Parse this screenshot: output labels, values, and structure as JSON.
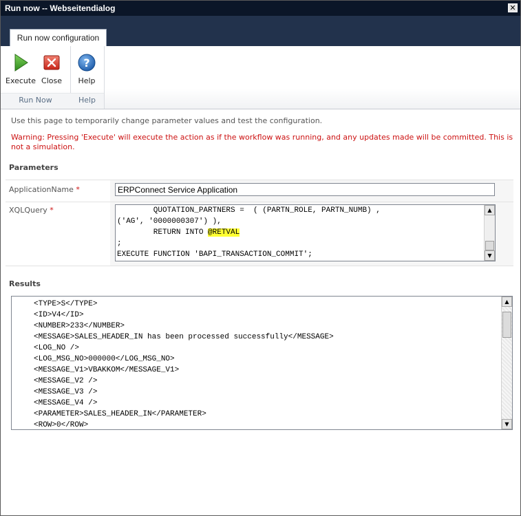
{
  "window": {
    "title": "Run now -- Webseitendialog",
    "close_glyph": "✕"
  },
  "ribbon": {
    "tab": "Run now configuration",
    "groups": [
      {
        "label": "Run Now",
        "buttons": [
          {
            "label": "Execute",
            "icon": "play-icon"
          },
          {
            "label": "Close",
            "icon": "close-icon"
          }
        ]
      },
      {
        "label": "Help",
        "buttons": [
          {
            "label": "Help",
            "icon": "help-icon"
          }
        ]
      }
    ]
  },
  "page": {
    "info": "Use this page to temporarily change parameter values and test the configuration.",
    "warning": "Warning: Pressing 'Execute' will execute the action as if the workflow was running, and any updates made will be committed. This is not a simulation.",
    "parameters_heading": "Parameters",
    "results_heading": "Results",
    "required_marker": "*"
  },
  "params": {
    "application_name": {
      "label": "ApplicationName",
      "value": "ERPConnect Service Application"
    },
    "xql_query": {
      "label": "XQLQuery",
      "line1": "        QUOTATION_PARTNERS =  ( (PARTN_ROLE, PARTN_NUMB) ,",
      "line2": "('AG', '0000000307') ),",
      "line3_prefix": "        RETURN INTO ",
      "line3_highlight": "@RETVAL",
      "line4": ";",
      "line5": "EXECUTE FUNCTION 'BAPI_TRANSACTION_COMMIT';"
    }
  },
  "results": {
    "lines": [
      "<TYPE>S</TYPE>",
      "<ID>V4</ID>",
      "<NUMBER>233</NUMBER>",
      "<MESSAGE>SALES_HEADER_IN has been processed successfully</MESSAGE>",
      "<LOG_NO />",
      "<LOG_MSG_NO>000000</LOG_MSG_NO>",
      "<MESSAGE_V1>VBAKKOM</MESSAGE_V1>",
      "<MESSAGE_V2 />",
      "<MESSAGE_V3 />",
      "<MESSAGE_V4 />",
      "<PARAMETER>SALES_HEADER_IN</PARAMETER>",
      "<ROW>0</ROW>"
    ]
  },
  "scroll": {
    "up": "▲",
    "down": "▼"
  },
  "colors": {
    "titlebar": "#0b1628",
    "ribbon_header": "#22324c",
    "warning": "#cc1111",
    "highlight": "#ffff33"
  }
}
